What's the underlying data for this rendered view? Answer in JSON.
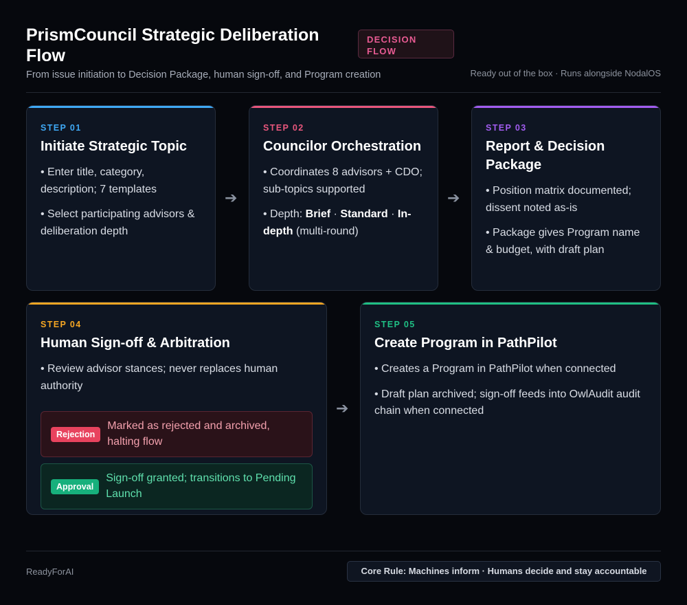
{
  "header": {
    "title": "PrismCouncil Strategic Deliberation Flow",
    "badge": "DECISION FLOW",
    "subtitle": "From issue initiation to Decision Package, human sign-off, and Program creation",
    "tagline": "Ready out of the box · Runs alongside NodalOS"
  },
  "steps": [
    {
      "label": "STEP 01",
      "title": "Initiate Strategic Topic",
      "accent": "#3fa9f5",
      "bullets": [
        "• Enter title, category, description; 7 templates",
        "• Select participating advisors & deliberation depth"
      ]
    },
    {
      "label": "STEP 02",
      "title": "Councilor Orchestration",
      "accent": "#e8567c",
      "bullets": [
        "• Coordinates 8 advisors + CDO; sub-topics supported"
      ],
      "depth": {
        "prefix": "• Depth: ",
        "brief": "Brief",
        "sep1": " · ",
        "standard": "Standard",
        "sep2": " · ",
        "indepth": "In-depth",
        "suffix": " (multi-round)"
      }
    },
    {
      "label": "STEP 03",
      "title": "Report & Decision Package",
      "accent": "#a25cf0",
      "bullets": [
        "• Position matrix documented; dissent noted as-is",
        "• Package gives Program name & budget, with draft plan"
      ]
    },
    {
      "label": "STEP 04",
      "title": "Human Sign-off & Arbitration",
      "accent": "#f5a623",
      "bullets": [
        "• Review advisor stances; never replaces human authority"
      ],
      "outcomes": {
        "rejection": {
          "pill": "Rejection",
          "text": "Marked as rejected and archived, halting flow",
          "color": "#e8435e"
        },
        "approval": {
          "pill": "Approval",
          "text": "Sign-off granted; transitions to Pending Launch",
          "color": "#17b07c"
        }
      }
    },
    {
      "label": "STEP 05",
      "title": "Create Program in PathPilot",
      "accent": "#1fbf84",
      "bullets": [
        "• Creates a Program in PathPilot when connected",
        "• Draft plan archived; sign-off feeds into OwlAudit audit chain when connected"
      ]
    }
  ],
  "arrow_glyph": "➔",
  "footer": {
    "brand": "ReadyForAI",
    "core_rule": "Core Rule: Machines inform · Humans decide and stay accountable"
  }
}
